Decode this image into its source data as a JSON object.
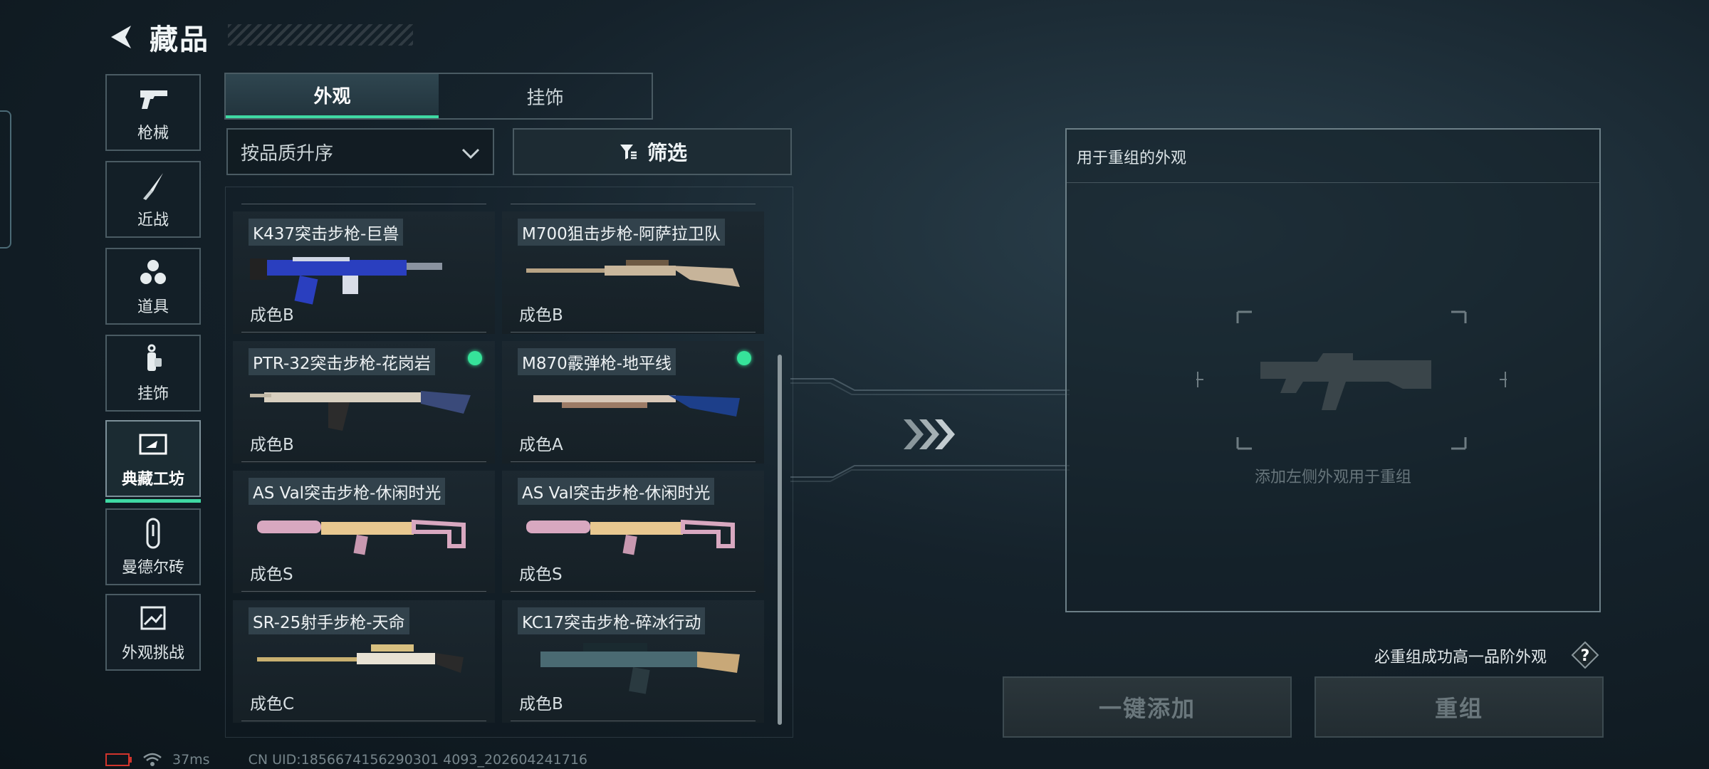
{
  "header": {
    "title": "藏品"
  },
  "sidebar": {
    "items": [
      {
        "label": "枪械",
        "icon": "pistol-icon"
      },
      {
        "label": "近战",
        "icon": "knife-icon"
      },
      {
        "label": "道具",
        "icon": "grenades-icon"
      },
      {
        "label": "挂饰",
        "icon": "charm-icon"
      },
      {
        "label": "典藏工坊",
        "icon": "workshop-icon",
        "active": true
      },
      {
        "label": "曼德尔砖",
        "icon": "mandel-brick-icon"
      },
      {
        "label": "外观挑战",
        "icon": "challenge-image-icon"
      }
    ]
  },
  "tabs": [
    {
      "label": "外观",
      "active": true
    },
    {
      "label": "挂饰",
      "active": false
    }
  ],
  "sort": {
    "value": "按品质升序"
  },
  "filter": {
    "label": "筛选"
  },
  "items": [
    {
      "name": "K437突击步枪-巨兽",
      "grade": "成色B",
      "equipped": false,
      "skin": "blue-camo"
    },
    {
      "name": "M700狙击步枪-阿萨拉卫队",
      "grade": "成色B",
      "equipped": false,
      "skin": "ornate-bronze"
    },
    {
      "name": "PTR-32突击步枪-花岗岩",
      "grade": "成色B",
      "equipped": true,
      "skin": "granite"
    },
    {
      "name": "M870霰弹枪-地平线",
      "grade": "成色A",
      "equipped": true,
      "skin": "horizon"
    },
    {
      "name": "AS Val突击步枪-休闲时光",
      "grade": "成色S",
      "equipped": false,
      "skin": "gold-pink"
    },
    {
      "name": "AS Val突击步枪-休闲时光",
      "grade": "成色S",
      "equipped": false,
      "skin": "gold-pink"
    },
    {
      "name": "SR-25射手步枪-天命",
      "grade": "成色C",
      "equipped": false,
      "skin": "white-gold"
    },
    {
      "name": "KC17突击步枪-碎冰行动",
      "grade": "成色B",
      "equipped": false,
      "skin": "ice-camo"
    }
  ],
  "recombine": {
    "title": "用于重组的外观",
    "hint": "添加左侧外观用于重组",
    "rule": "必重组成功高一品阶外观",
    "add_button": "一键添加",
    "recombine_button": "重组"
  },
  "status": {
    "ping": "37ms",
    "uid": "CN UID:1856674156290301 4093_202604241716"
  },
  "colors": {
    "accent": "#3fd9a3",
    "equipped_dot": "#36e39a"
  }
}
